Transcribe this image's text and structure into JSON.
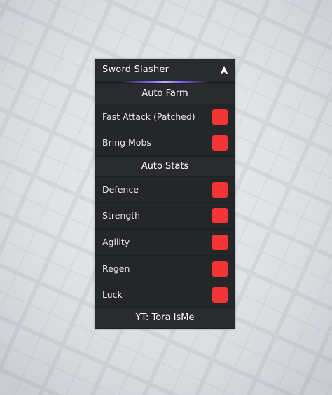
{
  "window": {
    "title": "Sword Slasher",
    "collapse_icon": "arrow-up-icon"
  },
  "colors": {
    "toggle_off": "#f33535",
    "panel": "#1f2023",
    "accent_glow": "#8a6cff"
  },
  "sections": {
    "auto_farm": {
      "label": "Auto Farm",
      "items": [
        {
          "label": "Fast Attack (Patched)",
          "enabled": false
        },
        {
          "label": "Bring Mobs",
          "enabled": false
        }
      ]
    },
    "auto_stats": {
      "label": "Auto Stats",
      "items": [
        {
          "label": "Defence",
          "enabled": false
        },
        {
          "label": "Strength",
          "enabled": false
        },
        {
          "label": "Agility",
          "enabled": false
        },
        {
          "label": "Regen",
          "enabled": false
        },
        {
          "label": "Luck",
          "enabled": false
        }
      ]
    }
  },
  "footer": {
    "text": "YT: Tora IsMe"
  }
}
